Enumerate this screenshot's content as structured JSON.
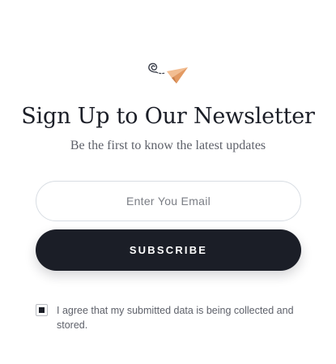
{
  "newsletter": {
    "icon": "paper-plane-icon",
    "title": "Sign Up to Our Newsletter",
    "subtitle": "Be the first to know the latest updates",
    "email_placeholder": "Enter You Email",
    "email_value": "",
    "subscribe_label": "SUBSCRIBE",
    "consent_checked": true,
    "consent_text": "I agree that my submitted data is being collected and stored."
  },
  "colors": {
    "primary": "#1b1e27",
    "accent_plane": "#e9a672",
    "text_muted": "#5e616a",
    "border": "#d8dde3",
    "background": "#ffffff"
  }
}
